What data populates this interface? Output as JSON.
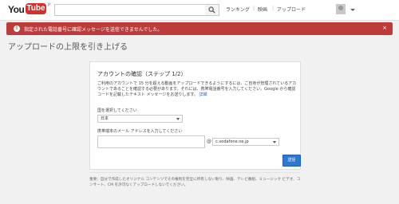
{
  "header": {
    "logo_you": "You",
    "logo_tube": "Tube",
    "logo_region": "JP",
    "search_placeholder": "",
    "nav": [
      "ランキング",
      "映画",
      "アップロード"
    ]
  },
  "alert": {
    "message": "指定された電話番号に確認メッセージを送信できませんでした。",
    "close": "×"
  },
  "page": {
    "title": "アップロードの上限を引き上げる"
  },
  "card": {
    "title": "アカウントの確認（ステップ 1/2）",
    "description": "ご利用のアカウントで 15 分を超える動画をアップロードできるようにするには、ご自身が管理されているアカウントであることを確認する必要があります。それには、携帯電話番号を入力してください。Google から確認コードを記載したテキスト メッセージをお送りします。",
    "details_link": "詳細",
    "country_label": "国を選択してください",
    "country_value": "日本",
    "email_label": "携帯端末のメール アドレスを入力してください",
    "email_value": "",
    "at_sign": "@",
    "domain_value": "c.vodafone.ne.jp",
    "send_button": "送信"
  },
  "footer": {
    "note": "重要：自分で作成したオリジナル コンテンツでその権利を完全に所有しない限り、映画、テレビ番組、ミュージック ビデオ、コンサート、CM を許可なくアップロードしないでください。"
  },
  "colors": {
    "alert_bg": "#bd3b3b",
    "brand_red": "#d5302a",
    "button_blue": "#2d79d2",
    "link_blue": "#2a63c5"
  },
  "icons": [
    "search-icon",
    "alert-icon",
    "close-icon",
    "chevron-down-icon",
    "avatar"
  ]
}
